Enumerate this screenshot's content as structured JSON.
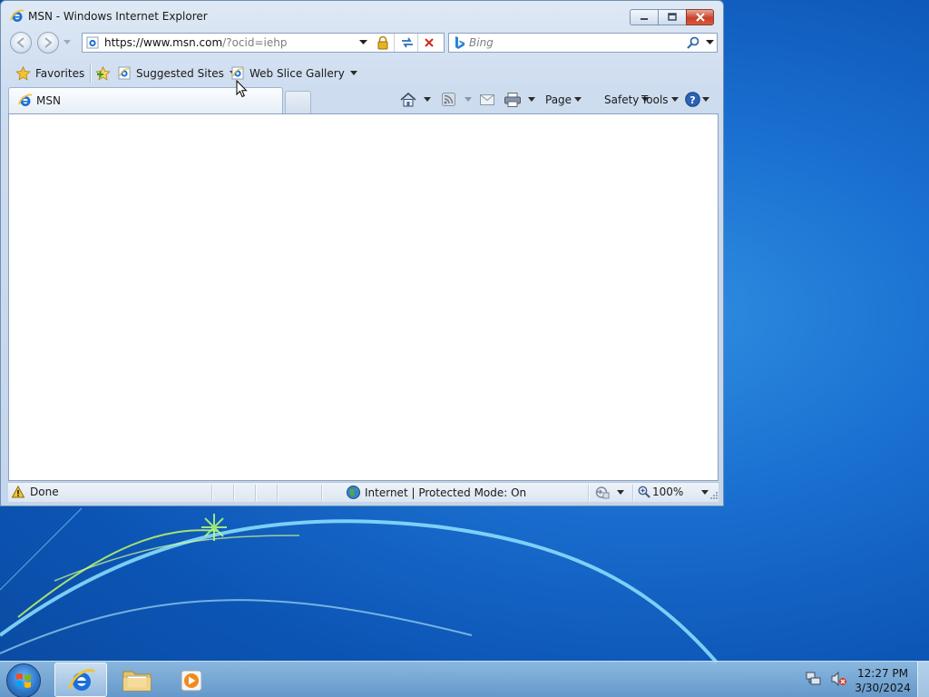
{
  "window": {
    "title": "MSN - Windows Internet Explorer"
  },
  "address_bar": {
    "url_main": "https://www.msn.com",
    "url_rest": "/?ocid=iehp"
  },
  "search": {
    "placeholder": "Bing"
  },
  "favorites_bar": {
    "favorites_label": "Favorites",
    "suggested_sites_label": "Suggested Sites",
    "web_slice_gallery_label": "Web Slice Gallery"
  },
  "tabs": [
    {
      "label": "MSN"
    }
  ],
  "command_bar": {
    "page_label": "Page",
    "safety_label": "Safety",
    "tools_label": "Tools"
  },
  "status_bar": {
    "status_text": "Done",
    "zone_text": "Internet | Protected Mode: On",
    "zoom_text": "100%"
  },
  "taskbar": {
    "time": "12:27 PM",
    "date": "3/30/2024"
  },
  "colors": {
    "desktop": "#1a6fd0",
    "window_frame": "#c4d6ec",
    "close_button": "#c8412a"
  }
}
